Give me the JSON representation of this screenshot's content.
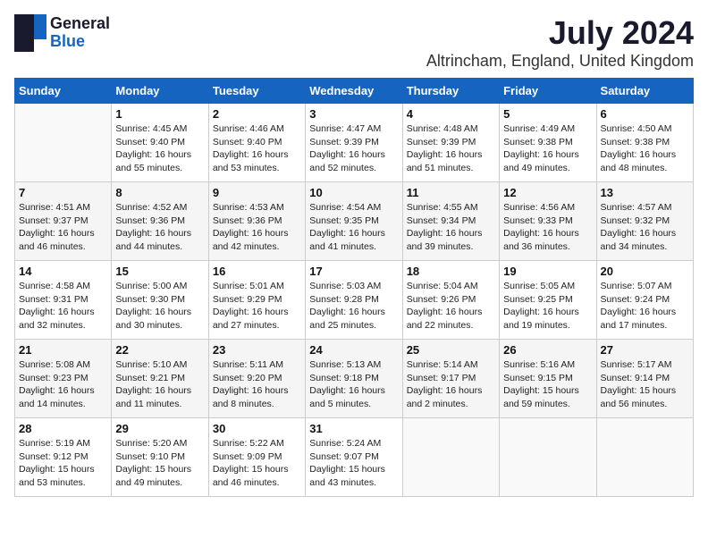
{
  "logo": {
    "general": "General",
    "blue": "Blue"
  },
  "title": "July 2024",
  "location": "Altrincham, England, United Kingdom",
  "days_of_week": [
    "Sunday",
    "Monday",
    "Tuesday",
    "Wednesday",
    "Thursday",
    "Friday",
    "Saturday"
  ],
  "weeks": [
    [
      {
        "day": "",
        "info": ""
      },
      {
        "day": "1",
        "info": "Sunrise: 4:45 AM\nSunset: 9:40 PM\nDaylight: 16 hours\nand 55 minutes."
      },
      {
        "day": "2",
        "info": "Sunrise: 4:46 AM\nSunset: 9:40 PM\nDaylight: 16 hours\nand 53 minutes."
      },
      {
        "day": "3",
        "info": "Sunrise: 4:47 AM\nSunset: 9:39 PM\nDaylight: 16 hours\nand 52 minutes."
      },
      {
        "day": "4",
        "info": "Sunrise: 4:48 AM\nSunset: 9:39 PM\nDaylight: 16 hours\nand 51 minutes."
      },
      {
        "day": "5",
        "info": "Sunrise: 4:49 AM\nSunset: 9:38 PM\nDaylight: 16 hours\nand 49 minutes."
      },
      {
        "day": "6",
        "info": "Sunrise: 4:50 AM\nSunset: 9:38 PM\nDaylight: 16 hours\nand 48 minutes."
      }
    ],
    [
      {
        "day": "7",
        "info": "Sunrise: 4:51 AM\nSunset: 9:37 PM\nDaylight: 16 hours\nand 46 minutes."
      },
      {
        "day": "8",
        "info": "Sunrise: 4:52 AM\nSunset: 9:36 PM\nDaylight: 16 hours\nand 44 minutes."
      },
      {
        "day": "9",
        "info": "Sunrise: 4:53 AM\nSunset: 9:36 PM\nDaylight: 16 hours\nand 42 minutes."
      },
      {
        "day": "10",
        "info": "Sunrise: 4:54 AM\nSunset: 9:35 PM\nDaylight: 16 hours\nand 41 minutes."
      },
      {
        "day": "11",
        "info": "Sunrise: 4:55 AM\nSunset: 9:34 PM\nDaylight: 16 hours\nand 39 minutes."
      },
      {
        "day": "12",
        "info": "Sunrise: 4:56 AM\nSunset: 9:33 PM\nDaylight: 16 hours\nand 36 minutes."
      },
      {
        "day": "13",
        "info": "Sunrise: 4:57 AM\nSunset: 9:32 PM\nDaylight: 16 hours\nand 34 minutes."
      }
    ],
    [
      {
        "day": "14",
        "info": "Sunrise: 4:58 AM\nSunset: 9:31 PM\nDaylight: 16 hours\nand 32 minutes."
      },
      {
        "day": "15",
        "info": "Sunrise: 5:00 AM\nSunset: 9:30 PM\nDaylight: 16 hours\nand 30 minutes."
      },
      {
        "day": "16",
        "info": "Sunrise: 5:01 AM\nSunset: 9:29 PM\nDaylight: 16 hours\nand 27 minutes."
      },
      {
        "day": "17",
        "info": "Sunrise: 5:03 AM\nSunset: 9:28 PM\nDaylight: 16 hours\nand 25 minutes."
      },
      {
        "day": "18",
        "info": "Sunrise: 5:04 AM\nSunset: 9:26 PM\nDaylight: 16 hours\nand 22 minutes."
      },
      {
        "day": "19",
        "info": "Sunrise: 5:05 AM\nSunset: 9:25 PM\nDaylight: 16 hours\nand 19 minutes."
      },
      {
        "day": "20",
        "info": "Sunrise: 5:07 AM\nSunset: 9:24 PM\nDaylight: 16 hours\nand 17 minutes."
      }
    ],
    [
      {
        "day": "21",
        "info": "Sunrise: 5:08 AM\nSunset: 9:23 PM\nDaylight: 16 hours\nand 14 minutes."
      },
      {
        "day": "22",
        "info": "Sunrise: 5:10 AM\nSunset: 9:21 PM\nDaylight: 16 hours\nand 11 minutes."
      },
      {
        "day": "23",
        "info": "Sunrise: 5:11 AM\nSunset: 9:20 PM\nDaylight: 16 hours\nand 8 minutes."
      },
      {
        "day": "24",
        "info": "Sunrise: 5:13 AM\nSunset: 9:18 PM\nDaylight: 16 hours\nand 5 minutes."
      },
      {
        "day": "25",
        "info": "Sunrise: 5:14 AM\nSunset: 9:17 PM\nDaylight: 16 hours\nand 2 minutes."
      },
      {
        "day": "26",
        "info": "Sunrise: 5:16 AM\nSunset: 9:15 PM\nDaylight: 15 hours\nand 59 minutes."
      },
      {
        "day": "27",
        "info": "Sunrise: 5:17 AM\nSunset: 9:14 PM\nDaylight: 15 hours\nand 56 minutes."
      }
    ],
    [
      {
        "day": "28",
        "info": "Sunrise: 5:19 AM\nSunset: 9:12 PM\nDaylight: 15 hours\nand 53 minutes."
      },
      {
        "day": "29",
        "info": "Sunrise: 5:20 AM\nSunset: 9:10 PM\nDaylight: 15 hours\nand 49 minutes."
      },
      {
        "day": "30",
        "info": "Sunrise: 5:22 AM\nSunset: 9:09 PM\nDaylight: 15 hours\nand 46 minutes."
      },
      {
        "day": "31",
        "info": "Sunrise: 5:24 AM\nSunset: 9:07 PM\nDaylight: 15 hours\nand 43 minutes."
      },
      {
        "day": "",
        "info": ""
      },
      {
        "day": "",
        "info": ""
      },
      {
        "day": "",
        "info": ""
      }
    ]
  ]
}
